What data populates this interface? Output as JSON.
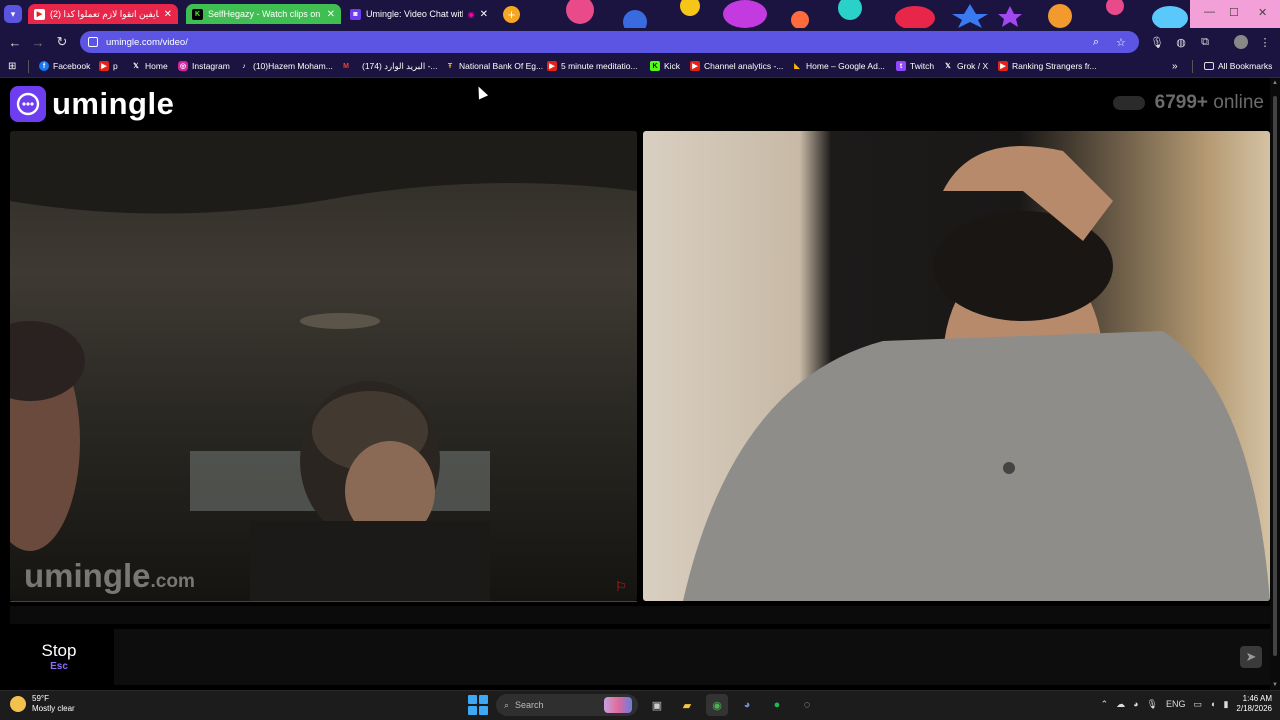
{
  "browser": {
    "tabs": [
      {
        "title": "(2) شايفين اتقوا لازم تعملوا كدا",
        "favicon": "youtube-icon",
        "active": false
      },
      {
        "title": "SelfHegazy - Watch clips on Ki",
        "favicon": "kick-icon",
        "active": false
      },
      {
        "title": "Umingle: Video Chat with S",
        "favicon": "umingle-icon",
        "active": true
      }
    ],
    "new_tab": "+",
    "url": "umingle.com/video/",
    "bookmarks": [
      {
        "label": "Facebook",
        "icon": "facebook-icon",
        "color": "#1877f2"
      },
      {
        "label": "p",
        "icon": "youtube-icon",
        "color": "#e62117"
      },
      {
        "label": "Home",
        "icon": "x-icon",
        "color": "#000000"
      },
      {
        "label": "Instagram",
        "icon": "instagram-icon",
        "color": "#d6249f"
      },
      {
        "label": "(10)Hazem Moham...",
        "icon": "tiktok-icon",
        "color": "#000000"
      },
      {
        "label": "",
        "icon": "gmail-icon",
        "color": "#ea4335"
      },
      {
        "label": "(174) البريد الوارد -...",
        "icon": "mail-icon",
        "color": "#ea4335"
      },
      {
        "label": "National Bank Of Eg...",
        "icon": "bank-icon",
        "color": "#0b6e3a"
      },
      {
        "label": "5 minute meditatio...",
        "icon": "youtube-icon",
        "color": "#e62117"
      },
      {
        "label": "Kick",
        "icon": "kick-icon",
        "color": "#53fc18"
      },
      {
        "label": "Channel analytics -...",
        "icon": "youtube-icon",
        "color": "#e62117"
      },
      {
        "label": "Home – Google Ad...",
        "icon": "google-ads-icon",
        "color": "#fbbc04"
      },
      {
        "label": "Twitch",
        "icon": "twitch-icon",
        "color": "#9146ff"
      },
      {
        "label": "Grok / X",
        "icon": "x-icon",
        "color": "#000000"
      },
      {
        "label": "Ranking Strangers fr...",
        "icon": "youtube-icon",
        "color": "#e62117"
      }
    ],
    "all_bookmarks": "All Bookmarks"
  },
  "site": {
    "logo_text": "umingle",
    "online_count": "6799+",
    "online_label": "online",
    "watermark_main": "umingle",
    "watermark_domain": ".com",
    "stop_label": "Stop",
    "stop_shortcut": "Esc",
    "accent": "#6d3ef0"
  },
  "taskbar": {
    "temperature": "59°F",
    "condition": "Mostly clear",
    "search_placeholder": "Search",
    "language": "ENG",
    "time": "1:46 AM",
    "date": "2/18/2026"
  }
}
